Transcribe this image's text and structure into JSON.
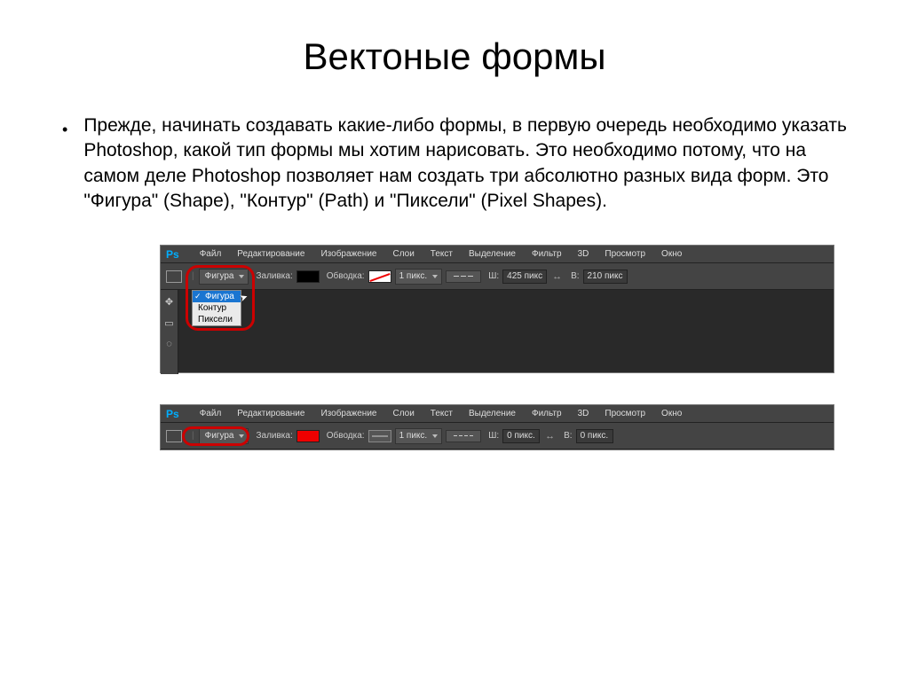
{
  "title": "Вектоные формы",
  "paragraph": "Прежде, начинать создавать какие-либо формы, в первую очередь необходимо указать Photoshop, какой тип формы мы хотим нарисовать. Это необходимо потому, что на самом деле Photoshop позволяет нам создать три абсолютно разных вида форм. Это \"Фигура\" (Shape), \"Контур\" (Path) и \"Пиксели\" (Pixel Shapes).",
  "ps_logo": "Ps",
  "menu": [
    "Файл",
    "Редактирование",
    "Изображение",
    "Слои",
    "Текст",
    "Выделение",
    "Фильтр",
    "3D",
    "Просмотр",
    "Окно"
  ],
  "toolbar": {
    "mode_label": "Фигура",
    "fill_label": "Заливка:",
    "stroke_label": "Обводка:",
    "size_1": "1 пикс.",
    "w_label": "Ш:",
    "h_label": "В:"
  },
  "shot1": {
    "w_value": "425 пикс",
    "h_value": "210 пикс",
    "dropdown": [
      "Фигура",
      "Контур",
      "Пиксели"
    ],
    "selected_index": 0
  },
  "shot2": {
    "w_value": "0 пикс.",
    "h_value": "0 пикс."
  }
}
